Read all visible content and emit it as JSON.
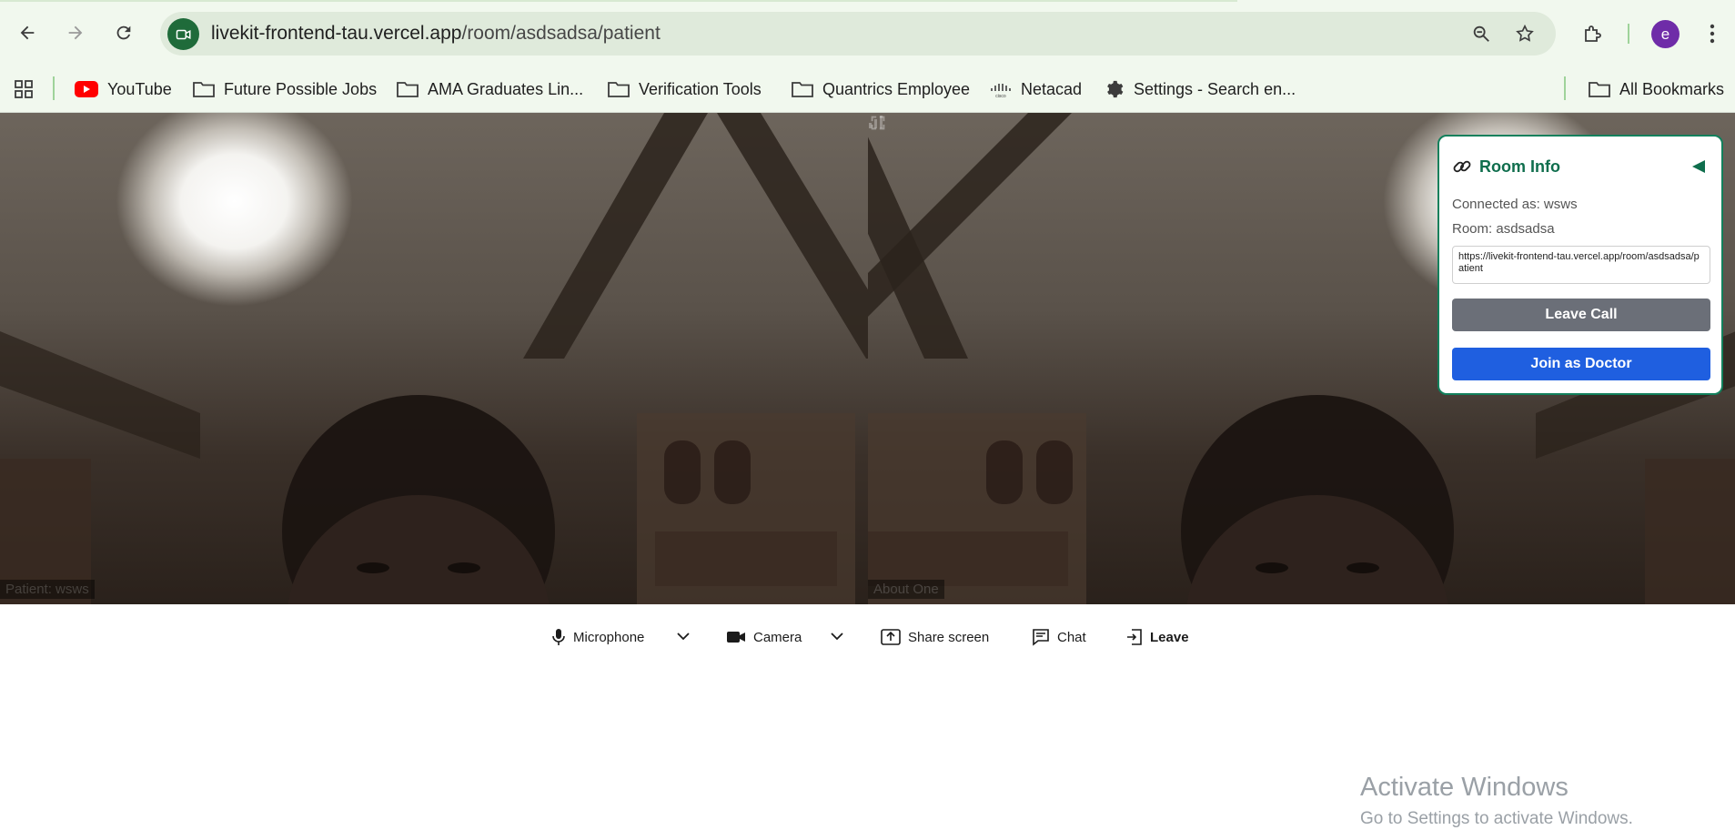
{
  "browser": {
    "url_host": "livekit-frontend-tau.vercel.app",
    "url_path": "/room/asdsadsa/patient",
    "profile_initial": "e"
  },
  "bookmarks": {
    "items": [
      {
        "label": "YouTube",
        "icon": "youtube-icon"
      },
      {
        "label": "Future Possible Jobs",
        "icon": "folder-icon"
      },
      {
        "label": "AMA Graduates Lin...",
        "icon": "folder-icon"
      },
      {
        "label": "Verification Tools",
        "icon": "folder-icon"
      },
      {
        "label": "Quantrics Employee",
        "icon": "folder-icon"
      },
      {
        "label": "Netacad",
        "icon": "cisco-icon"
      },
      {
        "label": "Settings - Search en...",
        "icon": "gear-icon"
      }
    ],
    "all_bookmarks": "All Bookmarks"
  },
  "video": {
    "left_tile_label": "Patient: wsws",
    "right_tile_label": "About One"
  },
  "room_info": {
    "title": "Room Info",
    "connected_as": "Connected as: wsws",
    "room": "Room: asdsadsa",
    "share_link": "https://livekit-frontend-tau.vercel.app/room/asdsadsa/patient",
    "leave_call_label": "Leave Call",
    "join_doctor_label": "Join as Doctor",
    "accent_color": "#12805c"
  },
  "controls": {
    "microphone": "Microphone",
    "camera": "Camera",
    "share_screen": "Share screen",
    "chat": "Chat",
    "leave": "Leave"
  },
  "watermark": {
    "title": "Activate Windows",
    "subtitle": "Go to Settings to activate Windows."
  }
}
